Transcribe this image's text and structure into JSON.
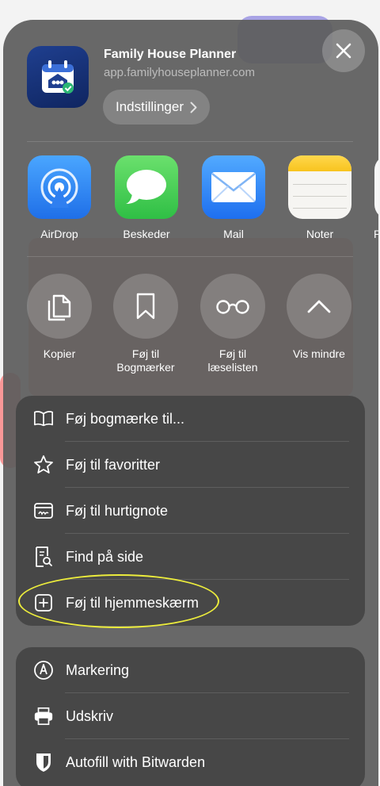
{
  "header": {
    "app_title": "Family House Planner",
    "app_url": "app.familyhouseplanner.com",
    "settings_label": "Indstillinger",
    "close_icon": "close-icon"
  },
  "share_apps": [
    {
      "label": "AirDrop",
      "icon": "airdrop-icon",
      "color": "#2f8cf6"
    },
    {
      "label": "Beskeder",
      "icon": "messages-icon",
      "color": "#35c84b"
    },
    {
      "label": "Mail",
      "icon": "mail-icon",
      "color": "#2d7ff3"
    },
    {
      "label": "Noter",
      "icon": "notes-icon",
      "color": "#f6f5f2"
    },
    {
      "label": "P",
      "icon": "partial-app-icon",
      "color": "#f6f6f6"
    }
  ],
  "actions": [
    {
      "label_line1": "Kopier",
      "label_line2": "",
      "icon": "copy-icon"
    },
    {
      "label_line1": "Føj til",
      "label_line2": "Bogmærker",
      "icon": "bookmark-icon"
    },
    {
      "label_line1": "Føj til",
      "label_line2": "læselisten",
      "icon": "reading-glasses-icon"
    },
    {
      "label_line1": "Vis mindre",
      "label_line2": "",
      "icon": "chevron-up-icon"
    }
  ],
  "menu_group1": [
    {
      "label": "Føj bogmærke til...",
      "icon": "open-book-icon"
    },
    {
      "label": "Føj til favoritter",
      "icon": "star-icon"
    },
    {
      "label": "Føj til hurtignote",
      "icon": "quick-note-icon"
    },
    {
      "label": "Find på side",
      "icon": "find-on-page-icon"
    },
    {
      "label": "Føj til hjemmeskærm",
      "icon": "add-square-icon"
    }
  ],
  "menu_group2": [
    {
      "label": "Markering",
      "icon": "markup-pen-icon"
    },
    {
      "label": "Udskriv",
      "icon": "printer-icon"
    },
    {
      "label": "Autofill with Bitwarden",
      "icon": "shield-icon"
    }
  ],
  "colors": {
    "sheet_bg": "#5c5c5c",
    "card_bg": "#474747",
    "highlight": "#ecec3c"
  }
}
